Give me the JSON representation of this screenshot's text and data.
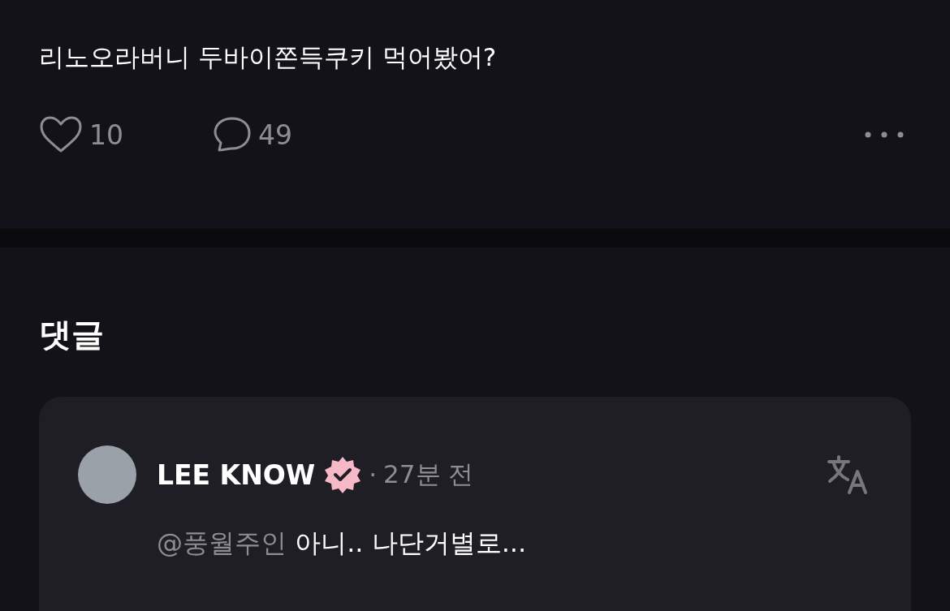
{
  "post": {
    "text": "리노오라버니 두바이쫀득쿠키 먹어봤어?",
    "likes": "10",
    "comments": "49"
  },
  "comments_section": {
    "title": "댓글",
    "comments": [
      {
        "author": "LEE KNOW",
        "verified": true,
        "separator": "·",
        "time": "27분 전",
        "mention": "@풍월주인",
        "text": "아니.. 나단거별로..."
      }
    ]
  }
}
